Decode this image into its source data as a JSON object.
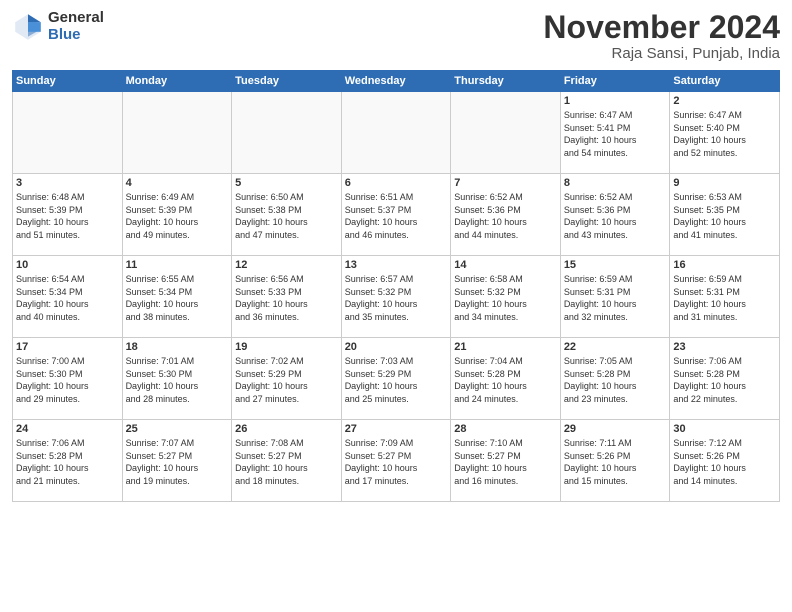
{
  "header": {
    "logo_general": "General",
    "logo_blue": "Blue",
    "month_title": "November 2024",
    "location": "Raja Sansi, Punjab, India"
  },
  "weekdays": [
    "Sunday",
    "Monday",
    "Tuesday",
    "Wednesday",
    "Thursday",
    "Friday",
    "Saturday"
  ],
  "weeks": [
    [
      {
        "day": "",
        "info": ""
      },
      {
        "day": "",
        "info": ""
      },
      {
        "day": "",
        "info": ""
      },
      {
        "day": "",
        "info": ""
      },
      {
        "day": "",
        "info": ""
      },
      {
        "day": "1",
        "info": "Sunrise: 6:47 AM\nSunset: 5:41 PM\nDaylight: 10 hours\nand 54 minutes."
      },
      {
        "day": "2",
        "info": "Sunrise: 6:47 AM\nSunset: 5:40 PM\nDaylight: 10 hours\nand 52 minutes."
      }
    ],
    [
      {
        "day": "3",
        "info": "Sunrise: 6:48 AM\nSunset: 5:39 PM\nDaylight: 10 hours\nand 51 minutes."
      },
      {
        "day": "4",
        "info": "Sunrise: 6:49 AM\nSunset: 5:39 PM\nDaylight: 10 hours\nand 49 minutes."
      },
      {
        "day": "5",
        "info": "Sunrise: 6:50 AM\nSunset: 5:38 PM\nDaylight: 10 hours\nand 47 minutes."
      },
      {
        "day": "6",
        "info": "Sunrise: 6:51 AM\nSunset: 5:37 PM\nDaylight: 10 hours\nand 46 minutes."
      },
      {
        "day": "7",
        "info": "Sunrise: 6:52 AM\nSunset: 5:36 PM\nDaylight: 10 hours\nand 44 minutes."
      },
      {
        "day": "8",
        "info": "Sunrise: 6:52 AM\nSunset: 5:36 PM\nDaylight: 10 hours\nand 43 minutes."
      },
      {
        "day": "9",
        "info": "Sunrise: 6:53 AM\nSunset: 5:35 PM\nDaylight: 10 hours\nand 41 minutes."
      }
    ],
    [
      {
        "day": "10",
        "info": "Sunrise: 6:54 AM\nSunset: 5:34 PM\nDaylight: 10 hours\nand 40 minutes."
      },
      {
        "day": "11",
        "info": "Sunrise: 6:55 AM\nSunset: 5:34 PM\nDaylight: 10 hours\nand 38 minutes."
      },
      {
        "day": "12",
        "info": "Sunrise: 6:56 AM\nSunset: 5:33 PM\nDaylight: 10 hours\nand 36 minutes."
      },
      {
        "day": "13",
        "info": "Sunrise: 6:57 AM\nSunset: 5:32 PM\nDaylight: 10 hours\nand 35 minutes."
      },
      {
        "day": "14",
        "info": "Sunrise: 6:58 AM\nSunset: 5:32 PM\nDaylight: 10 hours\nand 34 minutes."
      },
      {
        "day": "15",
        "info": "Sunrise: 6:59 AM\nSunset: 5:31 PM\nDaylight: 10 hours\nand 32 minutes."
      },
      {
        "day": "16",
        "info": "Sunrise: 6:59 AM\nSunset: 5:31 PM\nDaylight: 10 hours\nand 31 minutes."
      }
    ],
    [
      {
        "day": "17",
        "info": "Sunrise: 7:00 AM\nSunset: 5:30 PM\nDaylight: 10 hours\nand 29 minutes."
      },
      {
        "day": "18",
        "info": "Sunrise: 7:01 AM\nSunset: 5:30 PM\nDaylight: 10 hours\nand 28 minutes."
      },
      {
        "day": "19",
        "info": "Sunrise: 7:02 AM\nSunset: 5:29 PM\nDaylight: 10 hours\nand 27 minutes."
      },
      {
        "day": "20",
        "info": "Sunrise: 7:03 AM\nSunset: 5:29 PM\nDaylight: 10 hours\nand 25 minutes."
      },
      {
        "day": "21",
        "info": "Sunrise: 7:04 AM\nSunset: 5:28 PM\nDaylight: 10 hours\nand 24 minutes."
      },
      {
        "day": "22",
        "info": "Sunrise: 7:05 AM\nSunset: 5:28 PM\nDaylight: 10 hours\nand 23 minutes."
      },
      {
        "day": "23",
        "info": "Sunrise: 7:06 AM\nSunset: 5:28 PM\nDaylight: 10 hours\nand 22 minutes."
      }
    ],
    [
      {
        "day": "24",
        "info": "Sunrise: 7:06 AM\nSunset: 5:28 PM\nDaylight: 10 hours\nand 21 minutes."
      },
      {
        "day": "25",
        "info": "Sunrise: 7:07 AM\nSunset: 5:27 PM\nDaylight: 10 hours\nand 19 minutes."
      },
      {
        "day": "26",
        "info": "Sunrise: 7:08 AM\nSunset: 5:27 PM\nDaylight: 10 hours\nand 18 minutes."
      },
      {
        "day": "27",
        "info": "Sunrise: 7:09 AM\nSunset: 5:27 PM\nDaylight: 10 hours\nand 17 minutes."
      },
      {
        "day": "28",
        "info": "Sunrise: 7:10 AM\nSunset: 5:27 PM\nDaylight: 10 hours\nand 16 minutes."
      },
      {
        "day": "29",
        "info": "Sunrise: 7:11 AM\nSunset: 5:26 PM\nDaylight: 10 hours\nand 15 minutes."
      },
      {
        "day": "30",
        "info": "Sunrise: 7:12 AM\nSunset: 5:26 PM\nDaylight: 10 hours\nand 14 minutes."
      }
    ]
  ]
}
